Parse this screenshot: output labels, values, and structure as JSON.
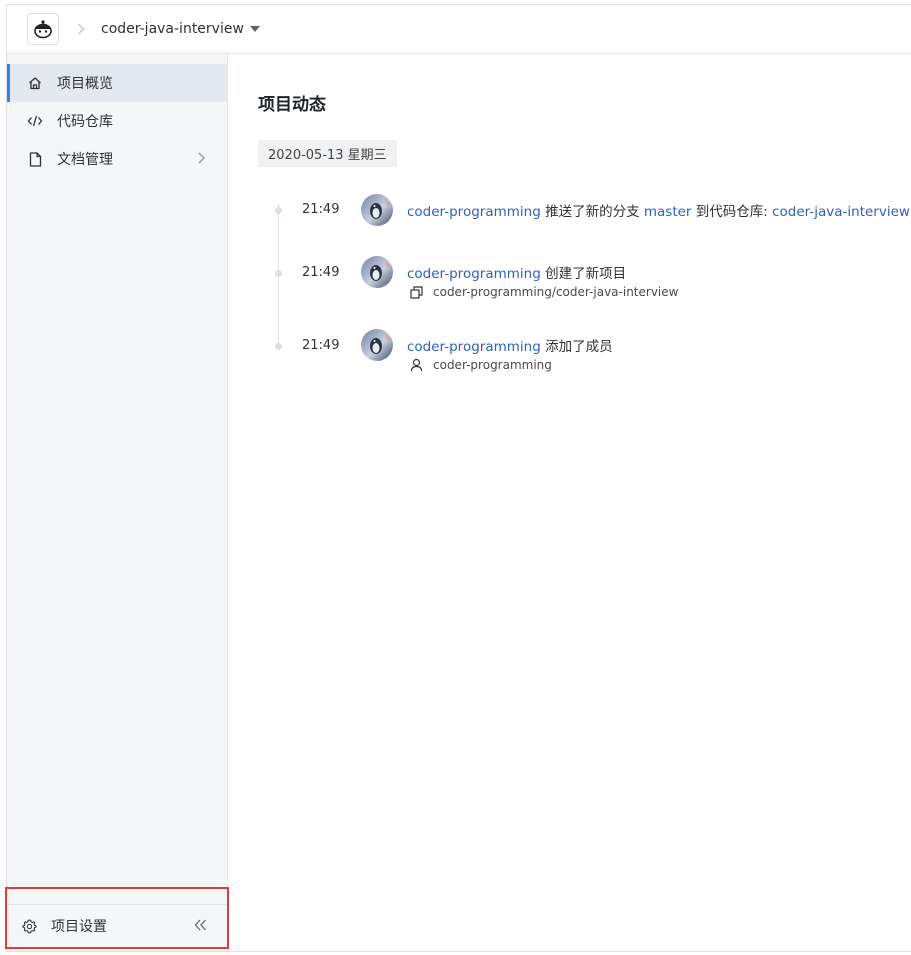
{
  "header": {
    "logo_icon": "mascot-logo-icon",
    "separator": ">",
    "project_name": "coder-java-interview"
  },
  "sidebar": {
    "items": [
      {
        "label": "项目概览",
        "icon": "home-icon",
        "active": true
      },
      {
        "label": "代码仓库",
        "icon": "code-icon",
        "active": false
      },
      {
        "label": "文档管理",
        "icon": "document-icon",
        "active": false,
        "has_children": true
      }
    ],
    "settings_label": "项目设置",
    "collapse_symbol": "«"
  },
  "main": {
    "title": "项目动态",
    "date": "2020-05-13 星期三",
    "activities": [
      {
        "time": "21:49",
        "user": "coder-programming",
        "action": " 推送了新的分支 ",
        "branch": "master",
        "middle": " 到代码仓库: ",
        "repo": "coder-java-interview"
      },
      {
        "time": "21:49",
        "user": "coder-programming",
        "action": " 创建了新项目",
        "detail": "coder-programming/coder-java-interview",
        "detail_icon": "copy-icon"
      },
      {
        "time": "21:49",
        "user": "coder-programming",
        "action": " 添加了成员",
        "detail": "coder-programming",
        "detail_icon": "user-icon"
      }
    ]
  },
  "colors": {
    "accent": "#3b7cf5",
    "link": "#2e62b8",
    "highlight_border": "#e03a3a"
  }
}
